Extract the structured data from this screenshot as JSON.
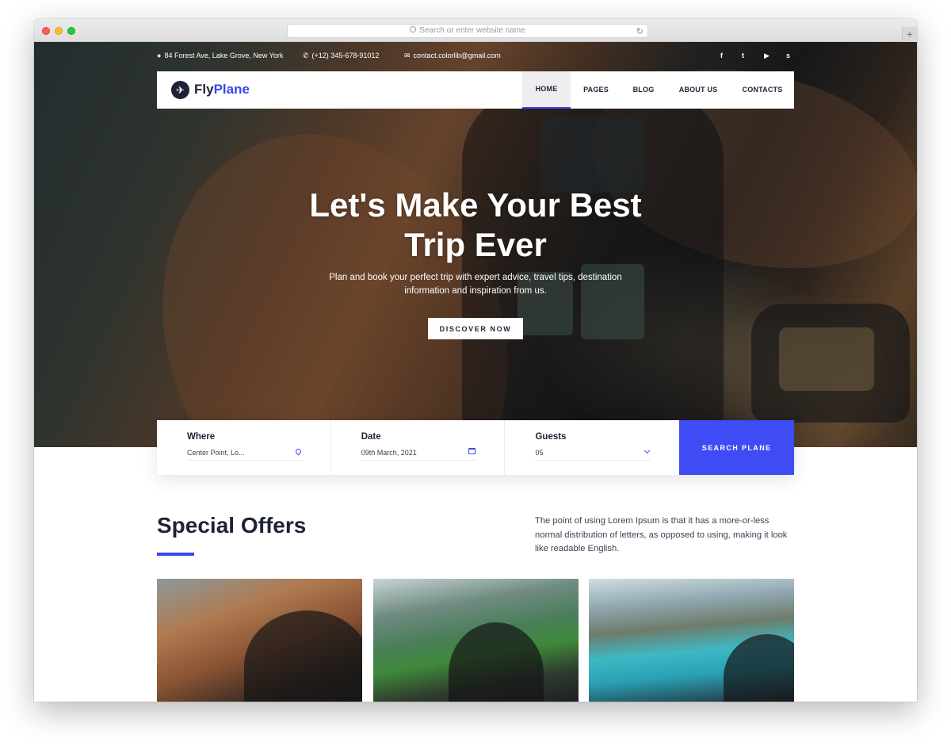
{
  "browser": {
    "url_placeholder": "Search or enter website name",
    "reload_icon": "reload-icon",
    "new_tab_label": "+"
  },
  "topbar": {
    "address": "84 Forest Ave, Lake Grove, New York",
    "phone": "(+12) 345-678-91012",
    "email": "contact.colorlib@gmail.com",
    "social": [
      "f",
      "t",
      "▶",
      "s"
    ]
  },
  "brand": {
    "name_dark": "Fly",
    "name_accent": "Plane",
    "accent_color": "#3a48ee"
  },
  "nav": {
    "items": [
      {
        "label": "HOME",
        "active": true
      },
      {
        "label": "PAGES"
      },
      {
        "label": "BLOG"
      },
      {
        "label": "ABOUT US"
      },
      {
        "label": "CONTACTS"
      }
    ]
  },
  "hero": {
    "title_line1": "Let's Make Your Best",
    "title_line2": "Trip Ever",
    "subtitle_line1": "Plan and book your perfect trip with expert advice, travel tips, destination",
    "subtitle_line2": "information and inspiration from us.",
    "cta_label": "DISCOVER NOW"
  },
  "booking": {
    "where": {
      "label": "Where",
      "value": "Center Point, Lo..."
    },
    "date": {
      "label": "Date",
      "value": "09th March, 2021"
    },
    "guests": {
      "label": "Guests",
      "value": "05"
    },
    "search_label": "SEARCH PLANE"
  },
  "offers": {
    "title": "Special Offers",
    "description": "The point of using Lorem Ipsum is that it has a more-or-less normal distribution of letters, as opposed to using, making it look like readable English."
  }
}
